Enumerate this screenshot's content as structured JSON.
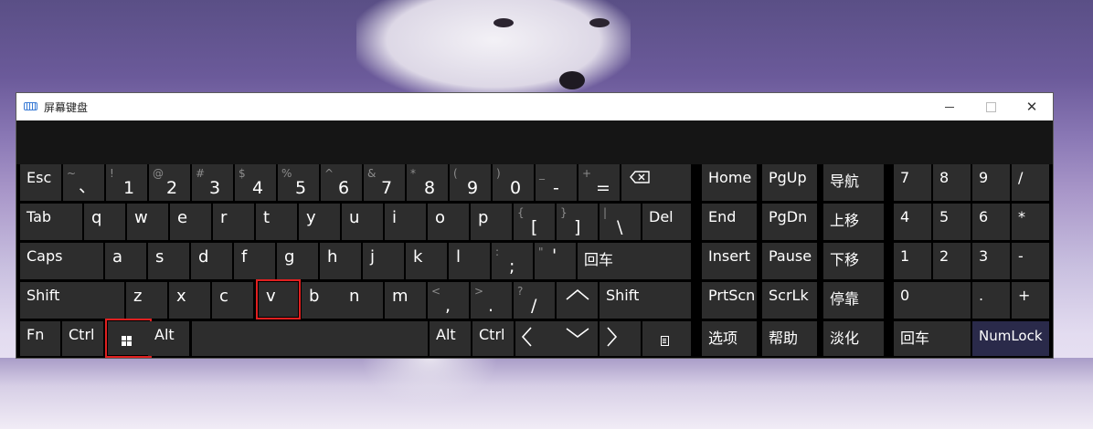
{
  "window": {
    "title": "屏幕键盘",
    "close_glyph": "✕"
  },
  "keys": {
    "esc": "Esc",
    "tilde": {
      "top": "~",
      "bottom": "、"
    },
    "d1": {
      "top": "!",
      "main": "1"
    },
    "d2": {
      "top": "@",
      "main": "2"
    },
    "d3": {
      "top": "#",
      "main": "3"
    },
    "d4": {
      "top": "$",
      "main": "4"
    },
    "d5": {
      "top": "%",
      "main": "5"
    },
    "d6": {
      "top": "^",
      "main": "6"
    },
    "d7": {
      "top": "&",
      "main": "7"
    },
    "d8": {
      "top": "*",
      "main": "8"
    },
    "d9": {
      "top": "(",
      "main": "9"
    },
    "d0": {
      "top": ")",
      "main": "0"
    },
    "minus": {
      "top": "_",
      "main": "-"
    },
    "equal": {
      "top": "+",
      "main": "="
    },
    "tab": "Tab",
    "q": "q",
    "w": "w",
    "e": "e",
    "r": "r",
    "t": "t",
    "y": "y",
    "u": "u",
    "i": "i",
    "o": "o",
    "p": "p",
    "lbracket": {
      "top": "{",
      "main": "["
    },
    "rbracket": {
      "top": "}",
      "main": "]"
    },
    "backslash": {
      "top": "|",
      "main": "\\"
    },
    "del": "Del",
    "caps": "Caps",
    "a": "a",
    "s": "s",
    "d": "d",
    "f": "f",
    "g": "g",
    "h": "h",
    "j": "j",
    "k": "k",
    "l": "l",
    "semicolon": {
      "top": ":",
      "main": ";"
    },
    "quote": {
      "top": "\"",
      "main": "'"
    },
    "enter": "回车",
    "shift_left": "Shift",
    "z": "z",
    "x": "x",
    "c": "c",
    "v": "v",
    "b": "b",
    "n": "n",
    "m": "m",
    "comma": {
      "top": "<",
      "main": ","
    },
    "period": {
      "top": ">",
      "main": "."
    },
    "slash": {
      "top": "?",
      "main": "/"
    },
    "shift_right": "Shift",
    "fn": "Fn",
    "ctrl_left": "Ctrl",
    "alt_left": "Alt",
    "alt_right": "Alt",
    "ctrl_right": "Ctrl"
  },
  "nav": {
    "home": "Home",
    "pgup": "PgUp",
    "nav": "导航",
    "end": "End",
    "pgdn": "PgDn",
    "moveup": "上移",
    "insert": "Insert",
    "pause": "Pause",
    "movedown": "下移",
    "prtscn": "PrtScn",
    "scrlk": "ScrLk",
    "dock": "停靠",
    "options": "选项",
    "help": "帮助",
    "fade": "淡化"
  },
  "numpad": {
    "n7": "7",
    "n8": "8",
    "n9": "9",
    "div": "/",
    "n4": "4",
    "n5": "5",
    "n6": "6",
    "mul": "*",
    "n1": "1",
    "n2": "2",
    "n3": "3",
    "sub": "-",
    "n0": "0",
    "dot": ".",
    "add": "+",
    "enter": "回车",
    "numlock": "NumLock"
  },
  "colors": {
    "key_bg": "#2d2d2d",
    "accent_key": "#2a2a4a",
    "highlight_outline": "#e02020"
  }
}
